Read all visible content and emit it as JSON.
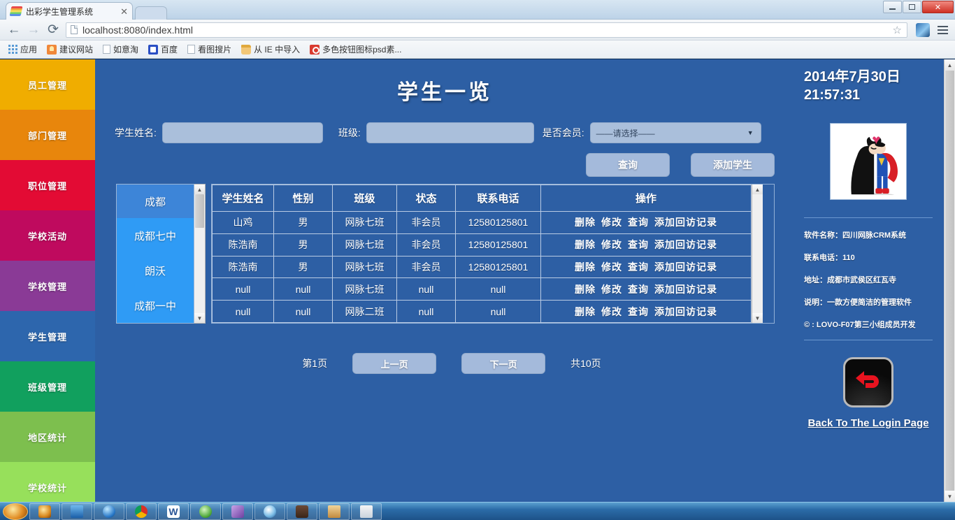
{
  "browser": {
    "tab_title": "出彩学生管理系统",
    "tab_close": "✕",
    "url": "localhost:8080/index.html",
    "back_icon": "←",
    "forward_icon": "→",
    "reload_icon": "⟳",
    "star_icon": "☆",
    "bookmarks": [
      {
        "label": "应用",
        "icon": "apps-grid-icon"
      },
      {
        "label": "建议网站",
        "icon": "bulb-icon"
      },
      {
        "label": "如意淘",
        "icon": "page-icon"
      },
      {
        "label": "百度",
        "icon": "baidu-icon"
      },
      {
        "label": "看图搜片",
        "icon": "page-icon"
      },
      {
        "label": "从 IE 中导入",
        "icon": "folder-icon"
      },
      {
        "label": "多色按钮图标psd素...",
        "icon": "red-circle-icon"
      }
    ]
  },
  "sidebar": {
    "items": [
      {
        "label": "员工管理",
        "color": "#f0ad00"
      },
      {
        "label": "部门管理",
        "color": "#e8860c"
      },
      {
        "label": "职位管理",
        "color": "#e30b34"
      },
      {
        "label": "学校活动",
        "color": "#bf0a5e"
      },
      {
        "label": "学校管理",
        "color": "#8a3a96"
      },
      {
        "label": "学生管理",
        "color": "#2d66ad"
      },
      {
        "label": "班级管理",
        "color": "#11a05e"
      },
      {
        "label": "地区统计",
        "color": "#7dbf4e"
      },
      {
        "label": "学校统计",
        "color": "#97e05b"
      }
    ]
  },
  "main": {
    "title": "学生一览",
    "form": {
      "name_label": "学生姓名:",
      "name_value": "",
      "class_label": "班级:",
      "class_value": "",
      "member_label": "是否会员:",
      "member_selected": "——请选择——",
      "member_caret": "▼"
    },
    "buttons": {
      "query": "查询",
      "add_student": "添加学生"
    },
    "city_list": {
      "header": "成都",
      "items": [
        "成都七中",
        "朗沃",
        "成都一中"
      ],
      "scroll_up": "▲",
      "scroll_down": "▼"
    },
    "table": {
      "columns": [
        "学生姓名",
        "性别",
        "班级",
        "状态",
        "联系电话",
        "操作"
      ],
      "ops": [
        "删除",
        "修改",
        "查询",
        "添加回访记录"
      ],
      "rows": [
        {
          "name": "山鸡",
          "gender": "男",
          "clazz": "网脉七班",
          "status": "非会员",
          "phone": "12580125801"
        },
        {
          "name": "陈浩南",
          "gender": "男",
          "clazz": "网脉七班",
          "status": "非会员",
          "phone": "12580125801"
        },
        {
          "name": "陈浩南",
          "gender": "男",
          "clazz": "网脉七班",
          "status": "非会员",
          "phone": "12580125801"
        },
        {
          "name": "null",
          "gender": "null",
          "clazz": "网脉七班",
          "status": "null",
          "phone": "null"
        },
        {
          "name": "null",
          "gender": "null",
          "clazz": "网脉二班",
          "status": "null",
          "phone": "null"
        }
      ],
      "scroll_up": "▲",
      "scroll_down": "▼"
    },
    "pager": {
      "current": "第1页",
      "prev": "上一页",
      "next": "下一页",
      "total": "共10页"
    }
  },
  "rightpanel": {
    "date": "2014年7月30日",
    "time": "21:57:31",
    "photo_alt": "batman-superman-cartoon",
    "info": [
      "软件名称：四川网脉CRM系统",
      "联系电话：110",
      "地址：成都市武侯区红瓦寺",
      "说明：一款方便简洁的管理软件",
      "© : LOVO-F07第三小组成员开发"
    ],
    "back_link": "Back To The Login Page",
    "back_icon": "back-arrow-icon"
  },
  "scrollbar": {
    "up": "▲",
    "down": "▼"
  },
  "window": {
    "minimize": "–",
    "maximize": "❐",
    "close": "✕"
  }
}
